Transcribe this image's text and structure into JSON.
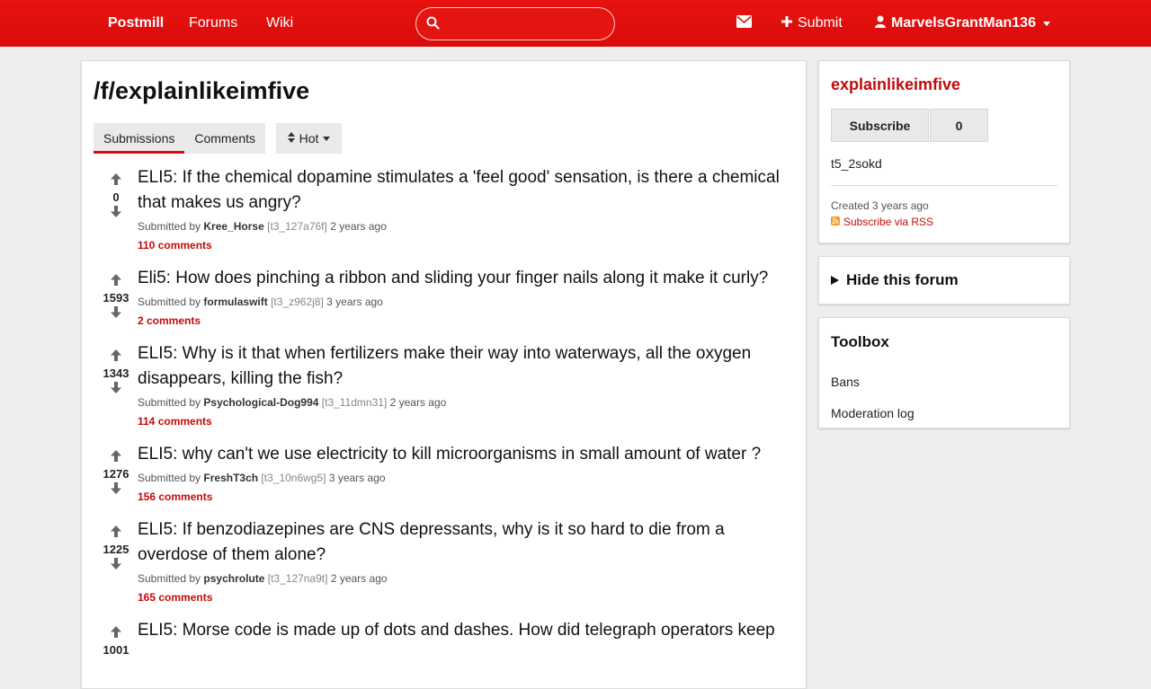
{
  "header": {
    "brand": "Postmill",
    "forums": "Forums",
    "wiki": "Wiki",
    "search_value": "",
    "submit": "Submit",
    "username": "MarvelsGrantMan136",
    "icons": [
      "search-icon",
      "envelope-icon",
      "plus-icon",
      "user-icon"
    ]
  },
  "main": {
    "title": "/f/explainlikeimfive",
    "tabs": [
      {
        "label": "Submissions",
        "active": true
      },
      {
        "label": "Comments",
        "active": false
      }
    ],
    "sort": "Hot",
    "posts": [
      {
        "score": "0",
        "title": "ELI5: If the chemical dopamine stimulates a 'feel good' sensation, is there a chemical that makes us angry?",
        "submitted_by": "Submitted by",
        "author": "Kree_Horse",
        "id": "[t3_127a76f]",
        "time": "2 years ago",
        "comments": "110 comments"
      },
      {
        "score": "1593",
        "title": "Eli5: How does pinching a ribbon and sliding your finger nails along it make it curly?",
        "submitted_by": "Submitted by",
        "author": "formulaswift",
        "id": "[t3_z962j8]",
        "time": "3 years ago",
        "comments": "2 comments"
      },
      {
        "score": "1343",
        "title": "ELI5: Why is it that when fertilizers make their way into waterways, all the oxygen disappears, killing the fish?",
        "submitted_by": "Submitted by",
        "author": "Psychological-Dog994",
        "id": "[t3_11dmn31]",
        "time": "2 years ago",
        "comments": "114 comments"
      },
      {
        "score": "1276",
        "title": "ELI5: why can't we use electricity to kill microorganisms in small amount of water ?",
        "submitted_by": "Submitted by",
        "author": "FreshT3ch",
        "id": "[t3_10n6wg5]",
        "time": "3 years ago",
        "comments": "156 comments"
      },
      {
        "score": "1225",
        "title": "ELI5: If benzodiazepines are CNS depressants, why is it so hard to die from a overdose of them alone?",
        "submitted_by": "Submitted by",
        "author": "psychrolute",
        "id": "[t3_127na9t]",
        "time": "2 years ago",
        "comments": "165 comments"
      },
      {
        "score": "1001",
        "title": "ELI5: Morse code is made up of dots and dashes. How did telegraph operators keep",
        "submitted_by": "",
        "author": "",
        "id": "",
        "time": "",
        "comments": ""
      }
    ]
  },
  "sidebar": {
    "forum_name": "explainlikeimfive",
    "subscribe": "Subscribe",
    "subscriber_count": "0",
    "forum_id": "t5_2sokd",
    "created": "Created 3 years ago",
    "rss": "Subscribe via RSS",
    "hide_forum": "Hide this forum",
    "toolbox_title": "Toolbox",
    "toolbox_links": [
      "Bans",
      "Moderation log"
    ]
  }
}
